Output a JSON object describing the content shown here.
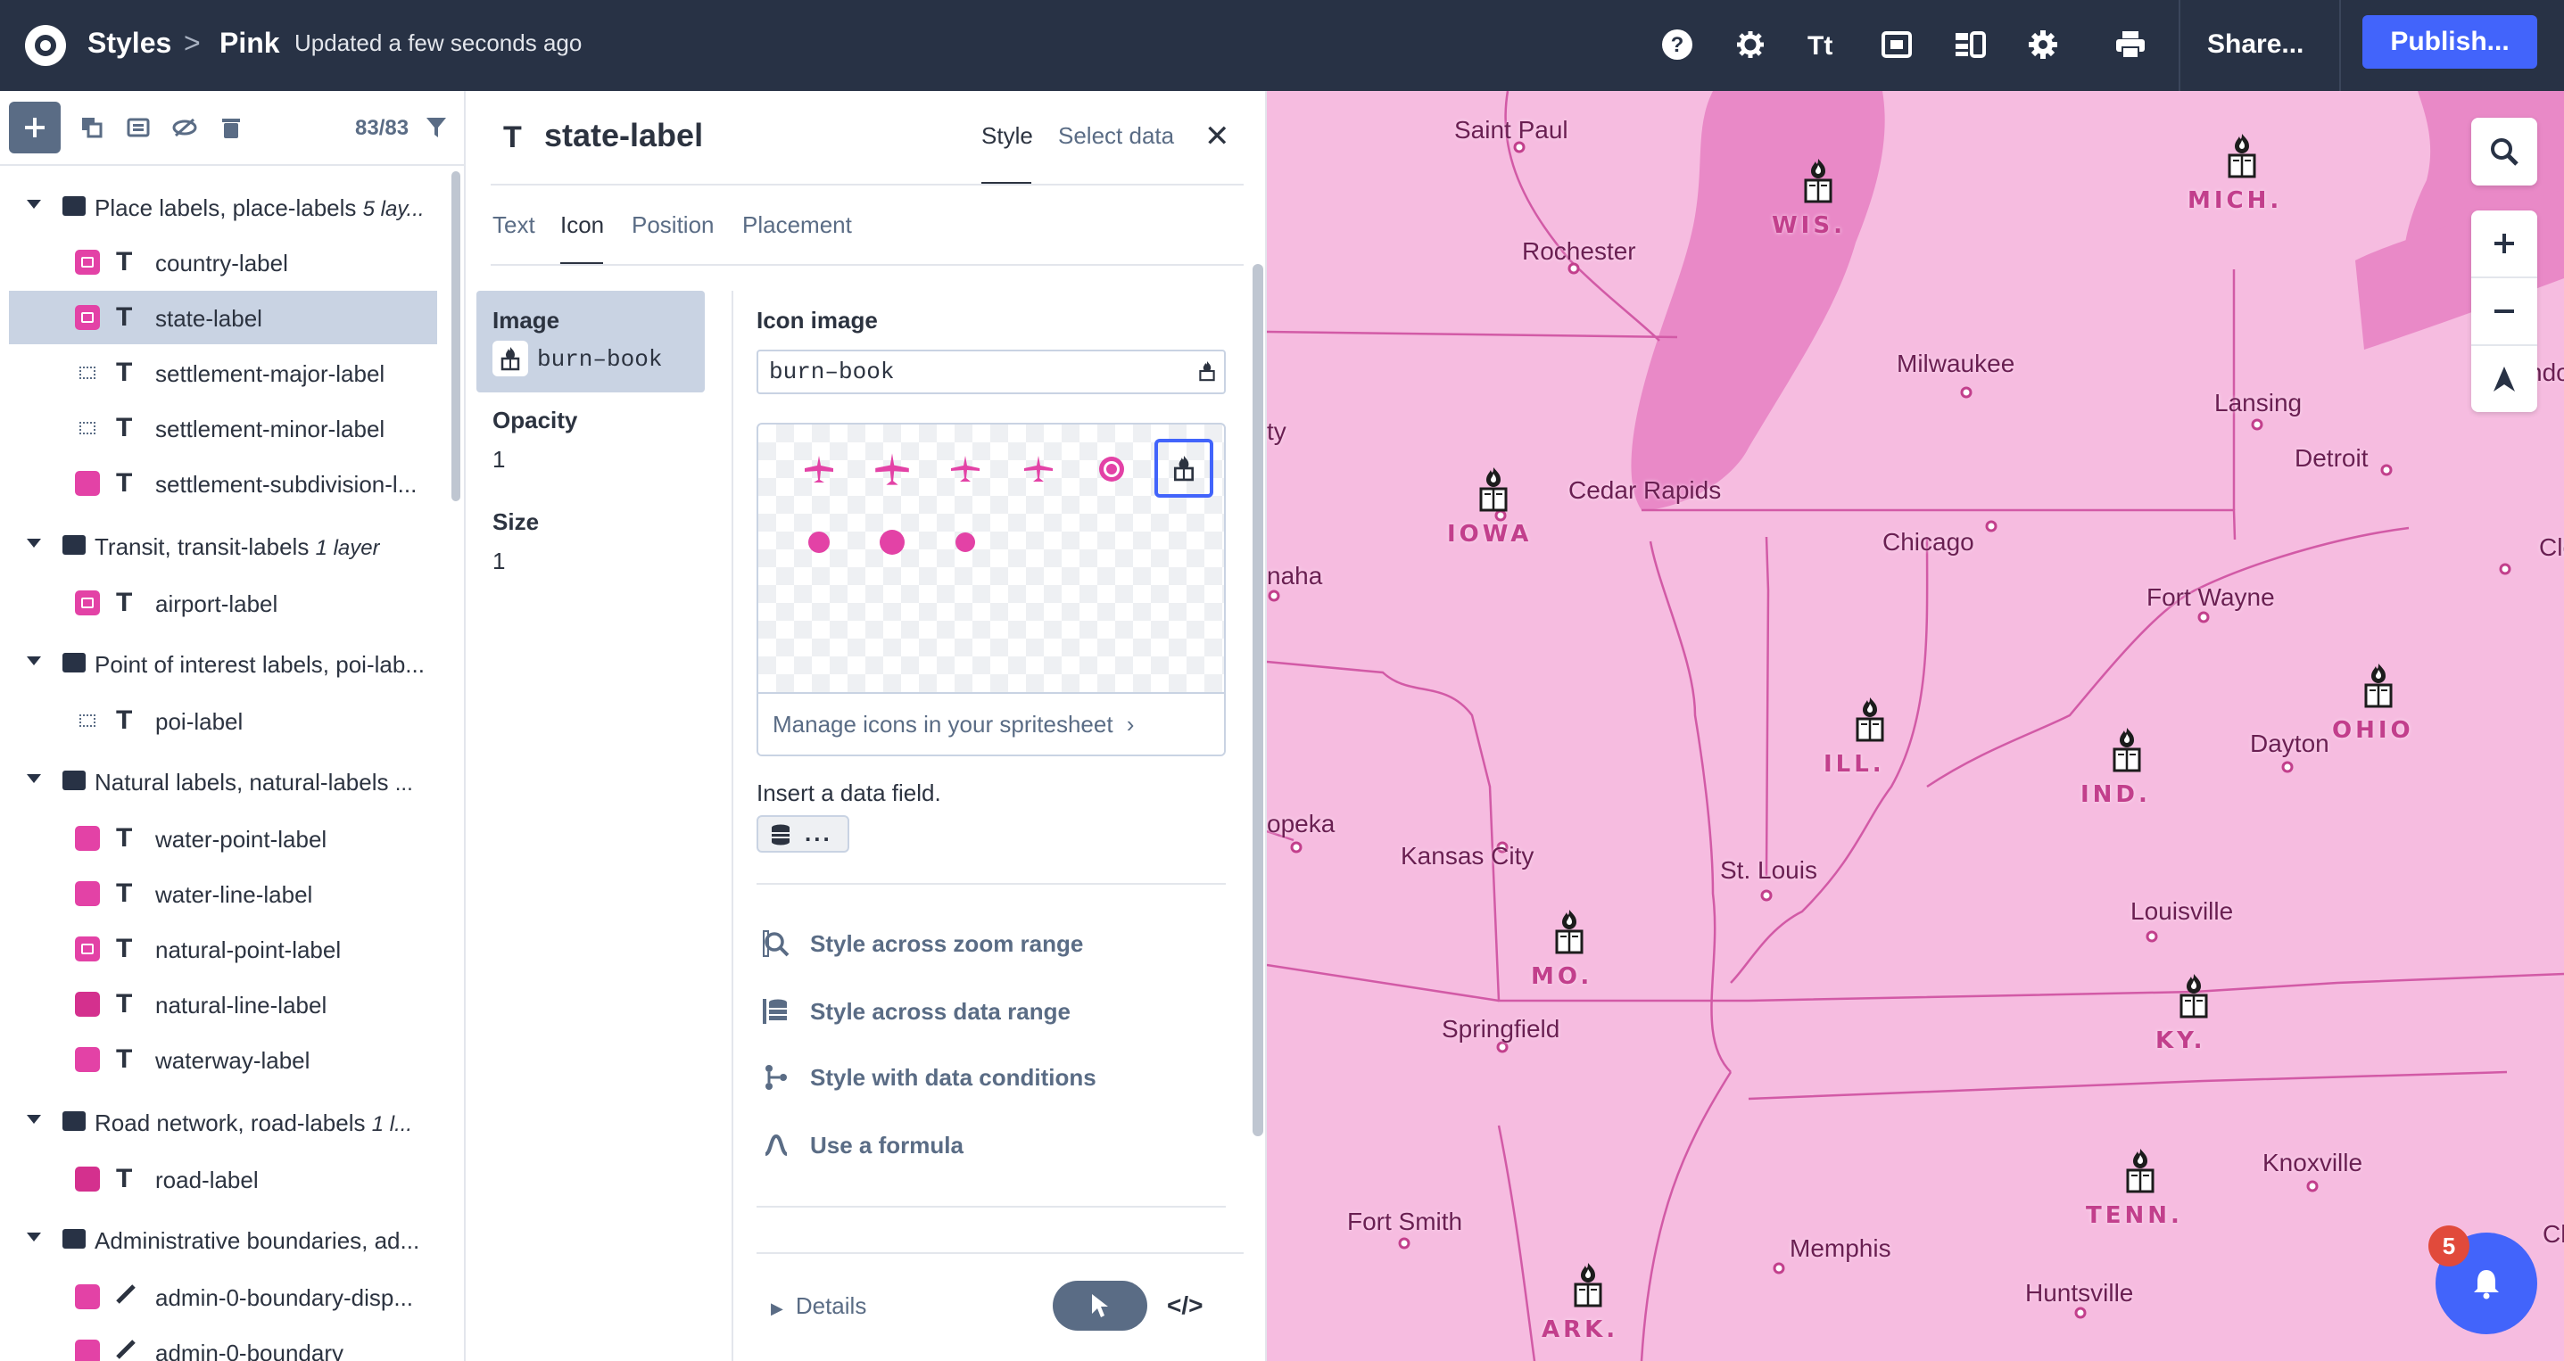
{
  "topbar": {
    "section": "Styles",
    "separator": ">",
    "style_name": "Pink",
    "updated": "Updated a few seconds ago",
    "share_label": "Share...",
    "publish_label": "Publish...",
    "icons": [
      "help-icon",
      "modify-icon",
      "typography-icon",
      "images-icon",
      "layers-icon",
      "settings-icon",
      "print-icon"
    ]
  },
  "layers": {
    "count": "83/83",
    "toolbar_icons": [
      "add-icon",
      "duplicate-icon",
      "group-icon",
      "hide-icon",
      "delete-icon",
      "filter-icon"
    ],
    "groups": [
      {
        "name": "Place labels, place-labels",
        "meta": "5 lay...",
        "items": [
          {
            "label": "country-label",
            "swatch": "icon"
          },
          {
            "label": "state-label",
            "swatch": "icon",
            "selected": true
          },
          {
            "label": "settlement-major-label",
            "swatch": "gray"
          },
          {
            "label": "settlement-minor-label",
            "swatch": "gray"
          },
          {
            "label": "settlement-subdivision-l...",
            "swatch": "pink"
          }
        ]
      },
      {
        "name": "Transit, transit-labels",
        "meta": "1 layer",
        "items": [
          {
            "label": "airport-label",
            "swatch": "icon"
          }
        ]
      },
      {
        "name": "Point of interest labels, poi-lab...",
        "meta": "",
        "items": [
          {
            "label": "poi-label",
            "swatch": "gray"
          }
        ]
      },
      {
        "name": "Natural labels, natural-labels",
        "meta": "...",
        "items": [
          {
            "label": "water-point-label",
            "swatch": "pink"
          },
          {
            "label": "water-line-label",
            "swatch": "pink"
          },
          {
            "label": "natural-point-label",
            "swatch": "icon"
          },
          {
            "label": "natural-line-label",
            "swatch": "darkpink"
          },
          {
            "label": "waterway-label",
            "swatch": "pink"
          }
        ]
      },
      {
        "name": "Road network, road-labels",
        "meta": "1 l...",
        "items": [
          {
            "label": "road-label",
            "swatch": "darkpink"
          }
        ]
      },
      {
        "name": "Administrative boundaries, ad...",
        "meta": "",
        "items": [
          {
            "label": "admin-0-boundary-disp...",
            "swatch": "pink"
          },
          {
            "label": "admin-0-boundary",
            "swatch": "pink"
          }
        ]
      }
    ]
  },
  "panel": {
    "type_glyph": "T",
    "layer_title": "state-label",
    "tabs": [
      "Style",
      "Select data"
    ],
    "active_tab": "Style",
    "subtabs": [
      "Text",
      "Icon",
      "Position",
      "Placement"
    ],
    "active_subtab": "Icon",
    "properties": [
      {
        "name": "Image",
        "value": "burn–book"
      },
      {
        "name": "Opacity",
        "value": "1"
      },
      {
        "name": "Size",
        "value": "1"
      }
    ],
    "icon_image_heading": "Icon image",
    "icon_image_value": "burn–book",
    "sprite_icons": [
      "airport-icon",
      "airport-icon",
      "airfield-icon",
      "airfield-icon",
      "dot-circle-icon",
      "burn-book-icon",
      "dot-icon",
      "dot-icon",
      "dot-icon"
    ],
    "manage_link": "Manage icons in your spritesheet",
    "insert_data_label": "Insert a data field.",
    "data_field_button": "...",
    "actions": [
      "Style across zoom range",
      "Style across data range",
      "Style with data conditions",
      "Use a formula"
    ],
    "details_label": "Details",
    "code_label": "</>"
  },
  "map": {
    "cities": [
      {
        "name": "Saint Paul"
      },
      {
        "name": "Rochester"
      },
      {
        "name": "Milwaukee"
      },
      {
        "name": "Lansing"
      },
      {
        "name": "Detroit"
      },
      {
        "name": "Cedar Rapids"
      },
      {
        "name": "Chicago"
      },
      {
        "name": "Fort Wayne"
      },
      {
        "name": "Kansas City"
      },
      {
        "name": "St. Louis"
      },
      {
        "name": "Dayton"
      },
      {
        "name": "Louisville"
      },
      {
        "name": "Springfield"
      },
      {
        "name": "Knoxville"
      },
      {
        "name": "Fort Smith"
      },
      {
        "name": "Memphis"
      },
      {
        "name": "Huntsville"
      },
      {
        "name": "opeka"
      },
      {
        "name": "naha"
      },
      {
        "name": "ty"
      },
      {
        "name": "Clev"
      },
      {
        "name": "ndo"
      },
      {
        "name": "Cha"
      }
    ],
    "states": [
      {
        "name": "WIS."
      },
      {
        "name": "MICH."
      },
      {
        "name": "IOWA"
      },
      {
        "name": "ILL."
      },
      {
        "name": "IND."
      },
      {
        "name": "OHIO"
      },
      {
        "name": "MO."
      },
      {
        "name": "KY."
      },
      {
        "name": "TENN."
      },
      {
        "name": "ARK."
      }
    ],
    "controls": [
      "search-icon",
      "zoom-in-icon",
      "zoom-out-icon",
      "compass-icon"
    ],
    "notification_count": "5",
    "colors": {
      "land": "#f6bce0",
      "water": "#e989c7",
      "border": "#d25aa6",
      "text": "#6a1f52",
      "state_text": "#c23f8c"
    }
  }
}
